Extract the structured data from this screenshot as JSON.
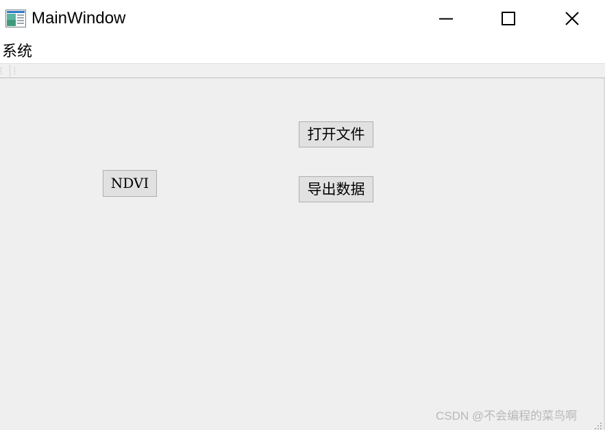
{
  "window": {
    "title": "MainWindow",
    "icon": "app-window-icon"
  },
  "titlebar": {
    "minimize_icon": "minimize-icon",
    "maximize_icon": "maximize-icon",
    "close_icon": "close-icon"
  },
  "menubar": {
    "items": [
      {
        "label": "系统"
      }
    ]
  },
  "main": {
    "buttons": {
      "open_file": "打开文件",
      "export_data": "导出数据",
      "ndvi": "NDVI"
    }
  },
  "watermark": "CSDN @不会编程的菜鸟啊",
  "colors": {
    "window_bg": "#efefef",
    "button_bg": "#e1e1e1",
    "button_border": "#adadad"
  }
}
